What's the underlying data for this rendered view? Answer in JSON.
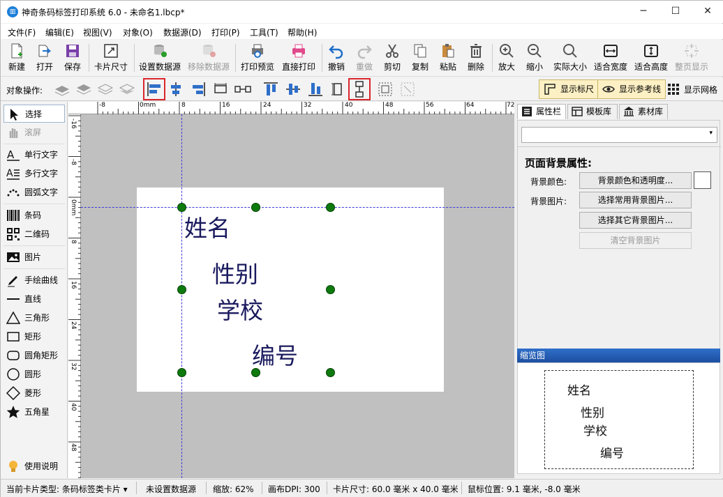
{
  "window": {
    "title": "神奇条码标签打印系统 6.0 - 未命名1.lbcp*",
    "minimize": "─",
    "maximize": "☐",
    "close": "✕"
  },
  "menu": [
    "文件(F)",
    "编辑(E)",
    "视图(V)",
    "对象(O)",
    "数据源(D)",
    "打印(P)",
    "工具(T)",
    "帮助(H)"
  ],
  "toolbar": {
    "new": "新建",
    "open": "打开",
    "save": "保存",
    "card_size": "卡片尺寸",
    "set_datasource": "设置数据源",
    "remove_datasource": "移除数据源",
    "print_preview": "打印预览",
    "direct_print": "直接打印",
    "undo": "撤销",
    "redo": "重做",
    "cut": "剪切",
    "copy": "复制",
    "paste": "粘贴",
    "delete": "删除",
    "zoom_in": "放大",
    "zoom_out": "缩小",
    "actual_size": "实际大小",
    "fit_width": "适合宽度",
    "fit_height": "适合高度",
    "full_page": "整页显示"
  },
  "objbar": {
    "label": "对象操作:",
    "show_ruler": "显示标尺",
    "show_guides": "显示参考线",
    "show_grid": "显示网格"
  },
  "tools": {
    "select": "选择",
    "scroll": "滚屏",
    "single_text": "单行文字",
    "multi_text": "多行文字",
    "arc_text": "圆弧文字",
    "barcode": "条码",
    "qrcode": "二维码",
    "image": "图片",
    "freehand": "手绘曲线",
    "line": "直线",
    "triangle": "三角形",
    "rect": "矩形",
    "round_rect": "圆角矩形",
    "circle": "圆形",
    "diamond": "菱形",
    "star": "五角星",
    "help": "使用说明"
  },
  "ruler": {
    "top": [
      "-8",
      "0mm",
      "8",
      "16",
      "24",
      "32",
      "40",
      "48",
      "56",
      "64",
      "72"
    ],
    "left": [
      "-16",
      "-8",
      "0mm",
      "8",
      "16",
      "24",
      "32",
      "40",
      "48"
    ]
  },
  "card": {
    "name": "姓名",
    "gender": "性别",
    "school": "学校",
    "number": "编号"
  },
  "right": {
    "tab_props": "属性栏",
    "tab_templates": "模板库",
    "tab_assets": "素材库",
    "section_title": "页面背景属性:",
    "bg_color_label": "背景颜色:",
    "bg_color_btn": "背景颜色和透明度...",
    "bg_image_label": "背景图片:",
    "bg_common_btn": "选择常用背景图片...",
    "bg_other_btn": "选择其它背景图片...",
    "bg_clear_btn": "清空背景图片",
    "thumb_title": "缩览图"
  },
  "status": {
    "card_type": "当前卡片类型: 条码标签类卡片 ▾",
    "datasource": "未设置数据源",
    "zoom": "缩放: 62%",
    "dpi": "画布DPI: 300",
    "card_size": "卡片尺寸: 60.0 毫米 x 40.0 毫米",
    "mouse_pos": "鼠标位置: 9.1 毫米, -8.0 毫米"
  }
}
